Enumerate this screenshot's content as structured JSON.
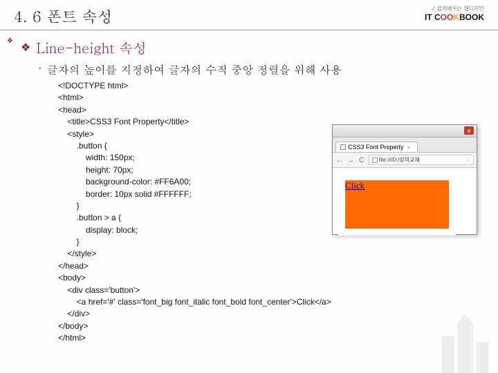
{
  "header": {
    "section_title": "4. 6 폰트 속성",
    "logo_tagline": "쉽게배우는 웹디자인",
    "logo_brand_it": "IT",
    "logo_brand_c": "C",
    "logo_brand_oo": "OO",
    "logo_brand_k": "K",
    "logo_brand_book": "BOOK"
  },
  "bullets": {
    "main": "Line-height 속성",
    "sub": "글자의 높이를 지정하여 글자의 수직 중앙 정렬을 위해 사용"
  },
  "code": "<!DOCTYPE html>\n<html>\n<head>\n    <title>CSS3 Font Property</title>\n    <style>\n        .button {\n            width: 150px;\n            height: 70px;\n            background-color: #FF6A00;\n            border: 10px solid #FFFFFF;\n        }\n        .button > a {\n            display: block;\n        }\n    </style>\n</head>\n<body>\n    <div class='button'>\n        <a href='#' class='font_big font_italic font_bold font_center'>Click</a>\n    </div>\n</body>\n</html>",
  "browser": {
    "tab_title": "CSS3 Font Property",
    "url": "file:///D:/강의교재",
    "close": "x",
    "tab_x": "×",
    "nav_back": "←",
    "nav_fwd": "→",
    "nav_reload": "C",
    "star": "☆",
    "link_text": "Click"
  }
}
